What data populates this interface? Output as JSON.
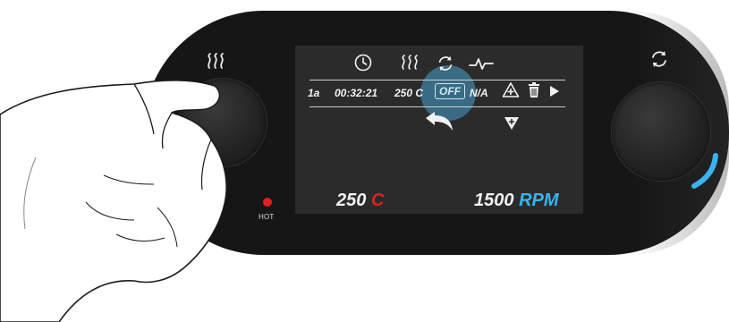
{
  "device": {
    "left_knob_icon": "heat-waves-icon",
    "right_knob_icon": "rotate-icon",
    "hot_indicator_label": "HOT",
    "colors": {
      "heat_accent": "#e32020",
      "speed_accent": "#3ab4f0",
      "body": "#161616",
      "screen": "#2b2b2b"
    }
  },
  "screen": {
    "header_icons": [
      "clock-icon",
      "heat-waves-icon",
      "rotate-icon",
      "pulse-icon"
    ],
    "program_row": {
      "step": "1a",
      "time": "00:32:21",
      "temperature": "250 C",
      "stir_state": "OFF",
      "extra": "N/A",
      "actions": [
        "add-step-icon",
        "delete-icon",
        "play-icon"
      ]
    },
    "back_icon": "back-arrow-icon",
    "insert_icon": "insert-below-icon",
    "temperature_readout": {
      "value": "250",
      "unit": "C"
    },
    "speed_readout": {
      "value": "1500",
      "unit": "RPM"
    }
  }
}
